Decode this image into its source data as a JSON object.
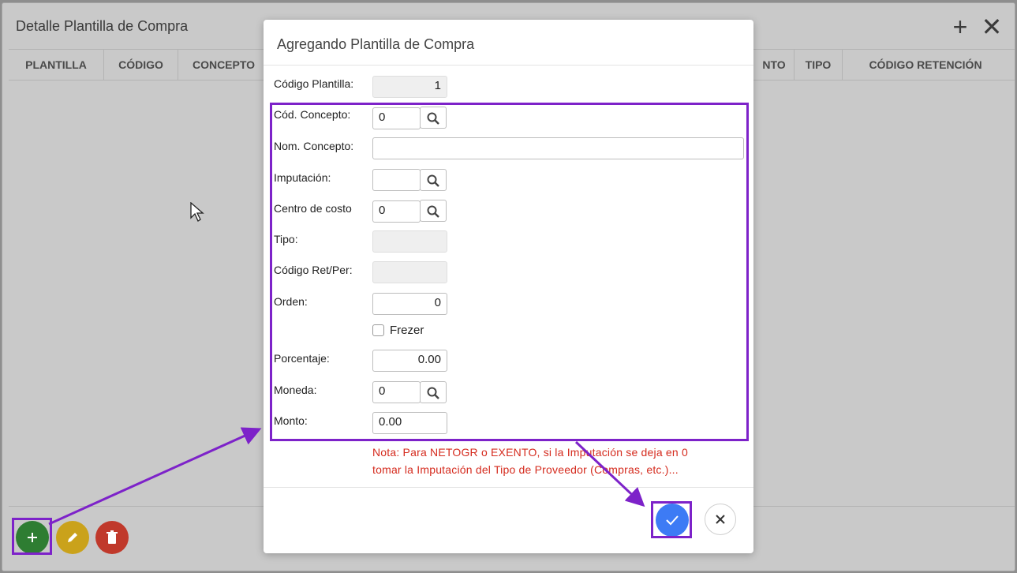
{
  "background": {
    "title": "Detalle Plantilla de Compra",
    "columns": [
      "PLANTILLA",
      "CÓDIGO",
      "CONCEPTO",
      "NTO",
      "TIPO",
      "CÓDIGO RETENCIÓN"
    ],
    "icons": [
      "plus-icon",
      "close-icon"
    ]
  },
  "modal": {
    "title": "Agregando Plantilla de Compra",
    "fields": {
      "codigo_plantilla": {
        "label": "Código Plantilla:",
        "value": "1"
      },
      "cod_concepto": {
        "label": "Cód. Concepto:",
        "value": "0"
      },
      "nom_concepto": {
        "label": "Nom. Concepto:",
        "value": ""
      },
      "imputacion": {
        "label": "Imputación:",
        "value": ""
      },
      "centro_costo": {
        "label": "Centro de costo",
        "value": "0"
      },
      "tipo": {
        "label": "Tipo:",
        "value": ""
      },
      "codigo_ret_per": {
        "label": "Código Ret/Per:",
        "value": ""
      },
      "orden": {
        "label": "Orden:",
        "value": "0"
      },
      "frezer": {
        "label": "Frezer",
        "checked": false
      },
      "porcentaje": {
        "label": "Porcentaje:",
        "value": "0.00"
      },
      "moneda": {
        "label": "Moneda:",
        "value": "0"
      },
      "monto": {
        "label": "Monto:",
        "value": "0.00"
      }
    },
    "note_line1": "Nota: Para NETOGR o EXENTO, si la Imputación se deja en 0",
    "note_line2": "tomar la Imputación del Tipo de Proveedor (Compras, etc.)..."
  },
  "colors": {
    "accent": "#3d7bf5",
    "annotation": "#7d22c9",
    "note": "#d52b1e",
    "add": "#2e7d32",
    "edit": "#caa21b",
    "delete": "#c0392b"
  }
}
